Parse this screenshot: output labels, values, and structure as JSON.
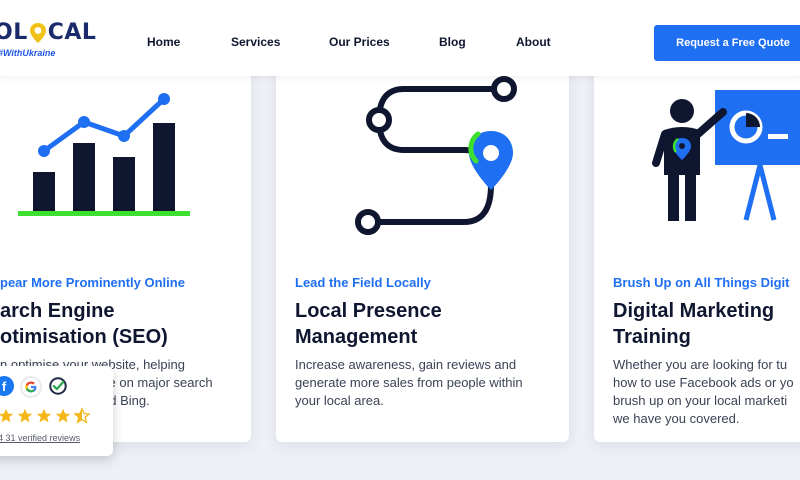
{
  "header": {
    "logo_text_left": "OL",
    "logo_text_right": "CAL",
    "logo_tagline": "#WithUkraine",
    "nav": [
      {
        "label": "Home"
      },
      {
        "label": "Services"
      },
      {
        "label": "Our Prices"
      },
      {
        "label": "Blog"
      },
      {
        "label": "About"
      }
    ],
    "cta_label": "Request a Free Quote"
  },
  "cards": [
    {
      "eyebrow": "pear More Prominently Online",
      "title_line1": "arch Engine",
      "title_line2": "otimisation (SEO)",
      "desc_line1": "n optimise your website, helping",
      "desc_line2": "ce on major search",
      "desc_line3": "nd Bing.",
      "illustration": "growth-chart-icon"
    },
    {
      "eyebrow": "Lead the Field Locally",
      "title_line1": "Local Presence",
      "title_line2": "Management",
      "desc_line1": "Increase awareness, gain reviews and",
      "desc_line2": "generate more sales from people within",
      "desc_line3": "your local area.",
      "illustration": "route-map-pin-icon"
    },
    {
      "eyebrow": "Brush Up on All Things Digit",
      "title_line1": "Digital Marketing",
      "title_line2": "Training",
      "desc_line1": "Whether you are looking for tu",
      "desc_line2": "how to use Facebook ads or yo",
      "desc_line3": "brush up on your local marketi",
      "desc_line4": "we have you covered.",
      "illustration": "presenter-board-icon"
    }
  ],
  "reviews": {
    "icons": [
      "facebook-icon",
      "google-icon",
      "verified-check-icon"
    ],
    "rating": 4.5,
    "count_text": "31 verified reviews",
    "count_prefix": "4"
  },
  "colors": {
    "brand_blue": "#1f6ff2",
    "navy": "#0f1630",
    "green": "#3ee030"
  }
}
